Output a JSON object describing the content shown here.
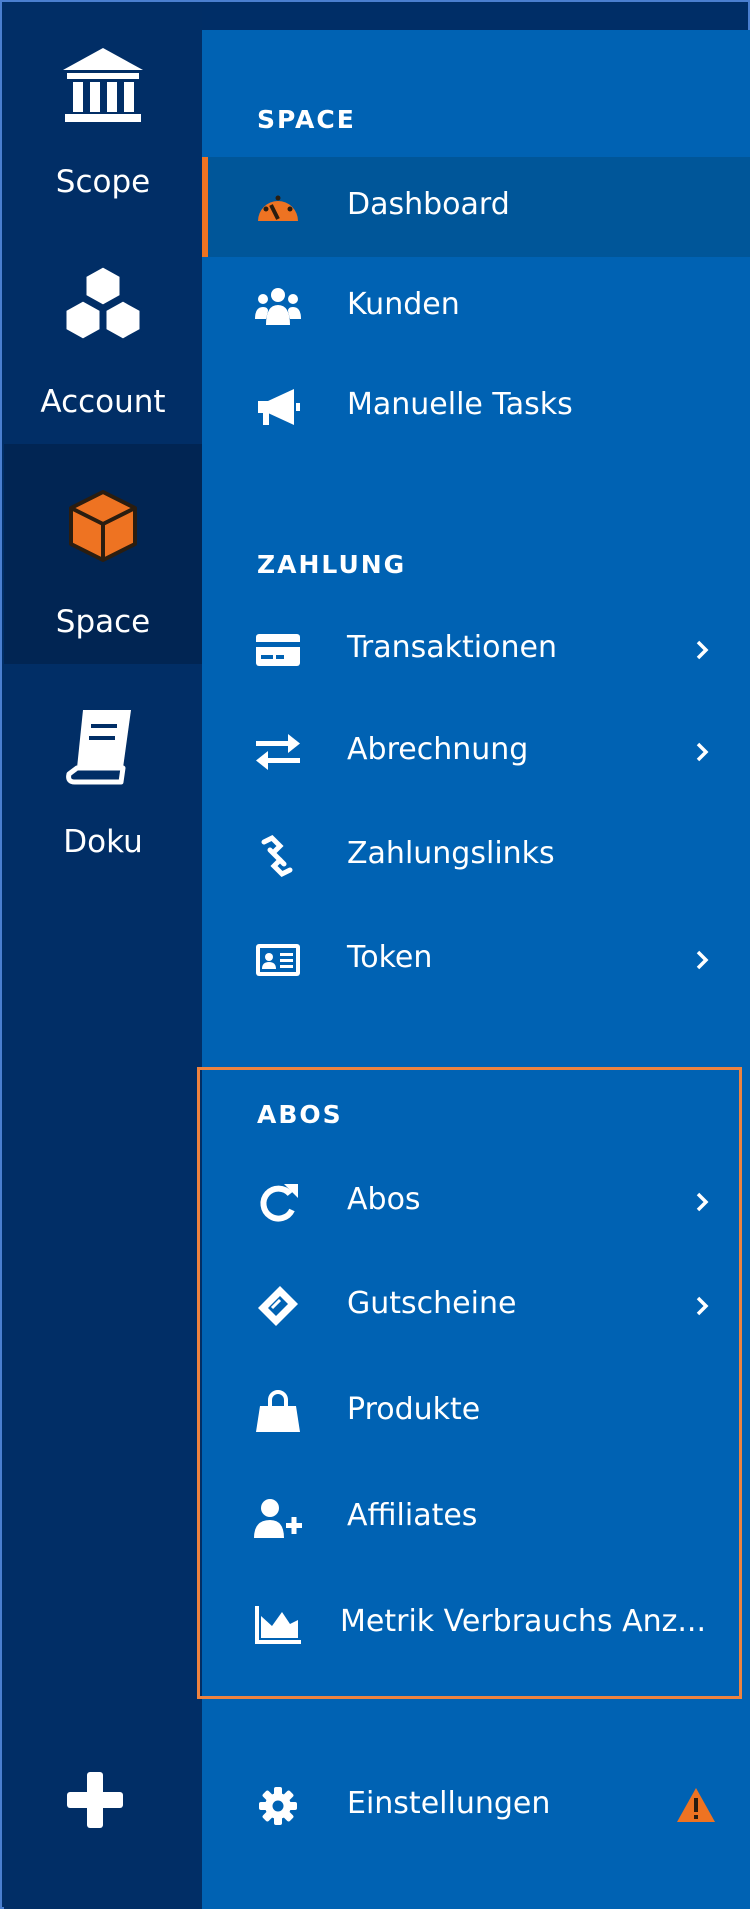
{
  "rail": {
    "items": [
      {
        "label": "Scope",
        "icon": "bank-icon"
      },
      {
        "label": "Account",
        "icon": "cubes-icon"
      },
      {
        "label": "Space",
        "icon": "cube-icon",
        "active": true
      },
      {
        "label": "Doku",
        "icon": "book-icon"
      }
    ],
    "add_icon": "plus-icon"
  },
  "sections": {
    "space": {
      "title": "SPACE",
      "items": [
        {
          "label": "Dashboard",
          "icon": "gauge-icon",
          "active": true
        },
        {
          "label": "Kunden",
          "icon": "users-icon"
        },
        {
          "label": "Manuelle Tasks",
          "icon": "megaphone-icon"
        }
      ]
    },
    "zahlung": {
      "title": "ZAHLUNG",
      "items": [
        {
          "label": "Transaktionen",
          "icon": "credit-card-icon",
          "has_submenu": true
        },
        {
          "label": "Abrechnung",
          "icon": "exchange-icon",
          "has_submenu": true
        },
        {
          "label": "Zahlungslinks",
          "icon": "link-icon"
        },
        {
          "label": "Token",
          "icon": "id-card-icon",
          "has_submenu": true
        }
      ]
    },
    "abos": {
      "title": "ABOS",
      "items": [
        {
          "label": "Abos",
          "icon": "refresh-icon",
          "has_submenu": true
        },
        {
          "label": "Gutscheine",
          "icon": "ticket-icon",
          "has_submenu": true
        },
        {
          "label": "Produkte",
          "icon": "shopping-bag-icon"
        },
        {
          "label": "Affiliates",
          "icon": "user-plus-icon"
        },
        {
          "label": "Metrik Verbrauchs Anz...",
          "icon": "area-chart-icon"
        }
      ]
    }
  },
  "footer": {
    "label": "Einstellungen",
    "icon": "gear-icon",
    "badge_icon": "warning-icon"
  },
  "colors": {
    "rail_bg": "#012e66",
    "rail_active_bg": "#012553",
    "panel_bg": "#0062b3",
    "active_item_bg": "#005699",
    "accent": "#ee7322",
    "highlight_outline": "#ee8340"
  }
}
